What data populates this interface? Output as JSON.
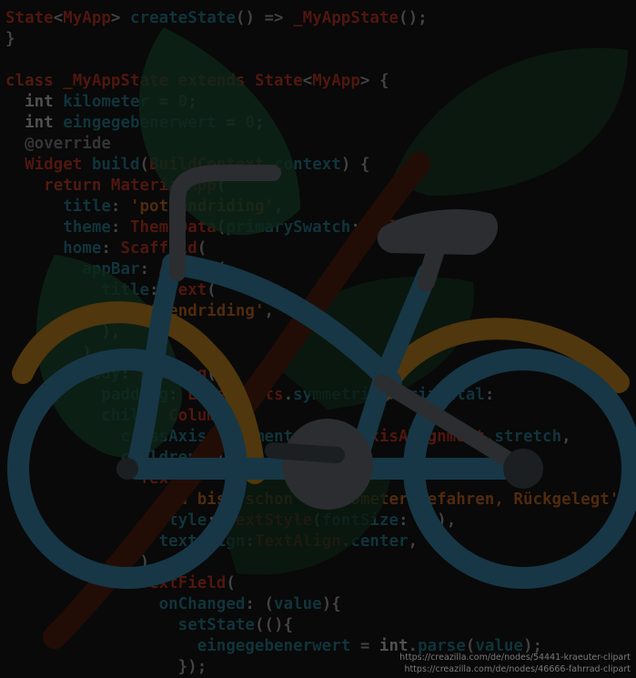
{
  "code": {
    "colors": {
      "keyword": "#6a2416",
      "type": "#6b6b6b",
      "func": "#17464f",
      "cls": "#6b1f14",
      "string": "#6b3a14",
      "plain": "#5a5a5a",
      "comment": "#474747",
      "number": "#3d3d3d"
    },
    "lines": [
      [
        [
          "cls",
          "State"
        ],
        [
          "plain",
          "<"
        ],
        [
          "cls",
          "MyApp"
        ],
        [
          "plain",
          "> "
        ],
        [
          "func",
          "createState"
        ],
        [
          "plain",
          "() => "
        ],
        [
          "cls",
          "_MyAppState"
        ],
        [
          "plain",
          "();"
        ]
      ],
      [
        [
          "plain",
          "}"
        ]
      ],
      [],
      [
        [
          "keyword",
          "class "
        ],
        [
          "cls",
          "_MyAppState "
        ],
        [
          "keyword",
          "extends "
        ],
        [
          "cls",
          "State"
        ],
        [
          "plain",
          "<"
        ],
        [
          "cls",
          "MyApp"
        ],
        [
          "plain",
          "> {"
        ]
      ],
      [
        [
          "plain",
          "  "
        ],
        [
          "type",
          "int "
        ],
        [
          "func",
          "kilometer "
        ],
        [
          "plain",
          "= "
        ],
        [
          "number",
          "0"
        ],
        [
          "plain",
          ";"
        ]
      ],
      [
        [
          "plain",
          "  "
        ],
        [
          "type",
          "int "
        ],
        [
          "func",
          "eingegebenerwert "
        ],
        [
          "plain",
          "= "
        ],
        [
          "number",
          "0"
        ],
        [
          "plain",
          ";"
        ]
      ],
      [
        [
          "plain",
          "  "
        ],
        [
          "comment",
          "@override"
        ]
      ],
      [
        [
          "plain",
          "  "
        ],
        [
          "cls",
          "Widget "
        ],
        [
          "func",
          "build"
        ],
        [
          "plain",
          "("
        ],
        [
          "cls",
          "BuildContext "
        ],
        [
          "func",
          "context"
        ],
        [
          "plain",
          ") {"
        ]
      ],
      [
        [
          "plain",
          "    "
        ],
        [
          "keyword",
          "return "
        ],
        [
          "cls",
          "MaterialApp"
        ],
        [
          "plain",
          "("
        ]
      ],
      [
        [
          "plain",
          "      "
        ],
        [
          "func",
          "title"
        ],
        [
          "plain",
          ": "
        ],
        [
          "string",
          "'pottendriding'"
        ],
        [
          "plain",
          ","
        ]
      ],
      [
        [
          "plain",
          "      "
        ],
        [
          "func",
          "theme"
        ],
        [
          "plain",
          ": "
        ],
        [
          "cls",
          "ThemeData"
        ],
        [
          "plain",
          "("
        ],
        [
          "func",
          "primarySwatch"
        ],
        [
          "plain",
          ": "
        ],
        [
          "cls",
          "Colors"
        ],
        [
          "plain",
          "."
        ]
      ],
      [
        [
          "plain",
          "      "
        ],
        [
          "func",
          "home"
        ],
        [
          "plain",
          ": "
        ],
        [
          "cls",
          "Scaffold"
        ],
        [
          "plain",
          "("
        ]
      ],
      [
        [
          "plain",
          "        "
        ],
        [
          "func",
          "appBar"
        ],
        [
          "plain",
          ": "
        ],
        [
          "cls",
          "AppBar"
        ],
        [
          "plain",
          "("
        ]
      ],
      [
        [
          "plain",
          "          "
        ],
        [
          "func",
          "title"
        ],
        [
          "plain",
          ": "
        ],
        [
          "cls",
          "Text"
        ],
        [
          "plain",
          "("
        ]
      ],
      [
        [
          "plain",
          "            "
        ],
        [
          "string",
          "'pottendriding'"
        ],
        [
          "plain",
          ","
        ]
      ],
      [
        [
          "plain",
          "          ),"
        ]
      ],
      [
        [
          "plain",
          "        ),"
        ]
      ],
      [
        [
          "plain",
          "        "
        ],
        [
          "func",
          "body"
        ],
        [
          "plain",
          ": "
        ],
        [
          "cls",
          "Padding"
        ],
        [
          "plain",
          "("
        ]
      ],
      [
        [
          "plain",
          "          "
        ],
        [
          "func",
          "padding"
        ],
        [
          "plain",
          ": "
        ],
        [
          "cls",
          "EdgeInsets"
        ],
        [
          "plain",
          "."
        ],
        [
          "func",
          "symmetric"
        ],
        [
          "plain",
          "("
        ],
        [
          "func",
          "horizontal"
        ],
        [
          "plain",
          ":"
        ]
      ],
      [
        [
          "plain",
          "          "
        ],
        [
          "func",
          "child"
        ],
        [
          "plain",
          ": "
        ],
        [
          "cls",
          "Column"
        ],
        [
          "plain",
          "("
        ]
      ],
      [
        [
          "plain",
          "            "
        ],
        [
          "func",
          "crossAxisAlignment"
        ],
        [
          "plain",
          ": "
        ],
        [
          "cls",
          "CrossAxisAlignment"
        ],
        [
          "plain",
          "."
        ],
        [
          "func",
          "stretch"
        ],
        [
          "plain",
          ","
        ]
      ],
      [
        [
          "plain",
          "            "
        ],
        [
          "func",
          "children"
        ],
        [
          "plain",
          ": ["
        ]
      ],
      [
        [
          "plain",
          "              "
        ],
        [
          "cls",
          "Text"
        ],
        [
          "plain",
          "("
        ]
      ],
      [
        [
          "plain",
          "                "
        ],
        [
          "string",
          "'Du bist schon 0 Kilometer gefahren, Rückgelegt'"
        ],
        [
          "plain",
          ","
        ]
      ],
      [
        [
          "plain",
          "                "
        ],
        [
          "func",
          "style"
        ],
        [
          "plain",
          ": "
        ],
        [
          "cls",
          "TextStyle"
        ],
        [
          "plain",
          "("
        ],
        [
          "func",
          "fontSize"
        ],
        [
          "plain",
          ": "
        ],
        [
          "number",
          "20"
        ],
        [
          "plain",
          "),"
        ]
      ],
      [
        [
          "plain",
          "                "
        ],
        [
          "func",
          "textAlign"
        ],
        [
          "plain",
          ":"
        ],
        [
          "cls",
          "TextAlign"
        ],
        [
          "plain",
          "."
        ],
        [
          "func",
          "center"
        ],
        [
          "plain",
          ","
        ]
      ],
      [
        [
          "plain",
          "              ),"
        ]
      ],
      [
        [
          "plain",
          "              "
        ],
        [
          "cls",
          "TextField"
        ],
        [
          "plain",
          "("
        ]
      ],
      [
        [
          "plain",
          "                "
        ],
        [
          "func",
          "onChanged"
        ],
        [
          "plain",
          ": ("
        ],
        [
          "func",
          "value"
        ],
        [
          "plain",
          "){"
        ]
      ],
      [
        [
          "plain",
          "                  "
        ],
        [
          "func",
          "setState"
        ],
        [
          "plain",
          "((){"
        ]
      ],
      [
        [
          "plain",
          "                    "
        ],
        [
          "func",
          "eingegebenerwert "
        ],
        [
          "plain",
          "= "
        ],
        [
          "type",
          "int"
        ],
        [
          "plain",
          "."
        ],
        [
          "func",
          "parse"
        ],
        [
          "plain",
          "("
        ],
        [
          "func",
          "value"
        ],
        [
          "plain",
          ");"
        ]
      ],
      [
        [
          "plain",
          "                  });"
        ]
      ]
    ]
  },
  "art": {
    "leaf_dark": "#0f2617",
    "leaf_mid": "#133220",
    "stem": "#2e1208",
    "bike_blue": "#1f4a5e",
    "bike_orange": "#6b4a12",
    "bike_gray": "#3a3d42",
    "bike_dark": "#262a2e"
  },
  "credits": {
    "line1": "https://creazilla.com/de/nodes/54441-kraeuter-clipart",
    "line2": "https://creazilla.com/de/nodes/46666-fahrrad-clipart"
  }
}
